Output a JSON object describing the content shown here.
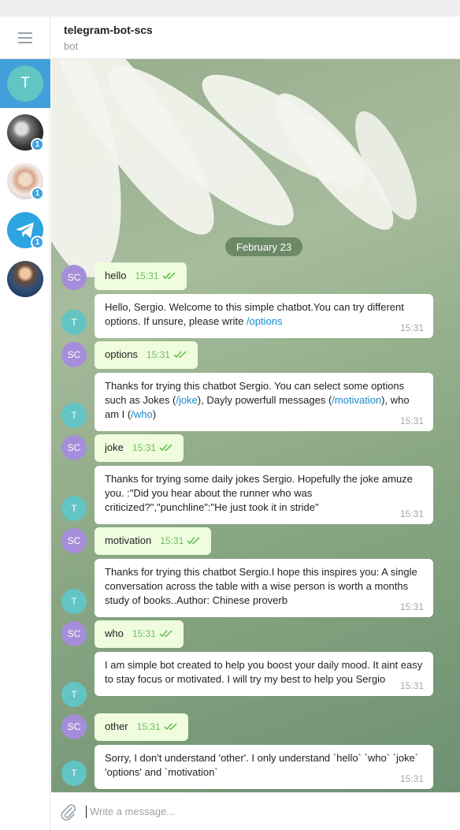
{
  "header": {
    "title": "telegram-bot-scs",
    "status": "bot"
  },
  "sidebar": {
    "items": [
      {
        "initial": "T",
        "badge": ""
      },
      {
        "initial": "",
        "badge": "1"
      },
      {
        "initial": "",
        "badge": "1"
      },
      {
        "initial": "",
        "badge": "1"
      },
      {
        "initial": "",
        "badge": ""
      }
    ]
  },
  "chat": {
    "date": "February 23",
    "user_initials": "SC",
    "bot_initial": "T",
    "messages": [
      {
        "from": "user",
        "text": "hello",
        "time": "15:31"
      },
      {
        "from": "bot",
        "parts": [
          "Hello, Sergio. Welcome to this simple chatbot.You can try different options. If unsure, please write ",
          "/options"
        ],
        "time": "15:31"
      },
      {
        "from": "user",
        "text": "options",
        "time": "15:31"
      },
      {
        "from": "bot",
        "parts": [
          "Thanks for trying this chatbot Sergio. You can select some options such as Jokes (",
          "/joke",
          "), Dayly powerfull messages (",
          "/motivation",
          "), who am I (",
          "/who",
          ")"
        ],
        "time": "15:31"
      },
      {
        "from": "user",
        "text": "joke",
        "time": "15:31"
      },
      {
        "from": "bot",
        "text": "Thanks for trying some daily jokes Sergio. Hopefully the joke amuze you.   :\"Did you hear about the runner who was criticized?\",\"punchline\":\"He just took it in stride\"",
        "time": "15:31"
      },
      {
        "from": "user",
        "text": "motivation",
        "time": "15:31"
      },
      {
        "from": "bot",
        "text": "Thanks for trying this chatbot Sergio.I hope this inspires you: A single conversation across the table with a wise person is worth a months study of books..Author: Chinese proverb",
        "time": "15:31"
      },
      {
        "from": "user",
        "text": "who",
        "time": "15:31"
      },
      {
        "from": "bot",
        "text": "I am simple bot created to help you boost your daily mood. It aint easy to stay focus or motivated. I will try my best to help you Sergio",
        "time": "15:31"
      },
      {
        "from": "user",
        "text": "other",
        "time": "15:31"
      },
      {
        "from": "bot",
        "text": "Sorry, I don't understand 'other'. I only understand `hello` `who` `joke` 'options' and `motivation`",
        "time": "15:31"
      }
    ]
  },
  "composer": {
    "placeholder": "Write a message..."
  },
  "colors": {
    "accent": "#419fd9",
    "out_bubble": "#effdde",
    "in_bubble": "#ffffff",
    "link": "#168acd"
  }
}
